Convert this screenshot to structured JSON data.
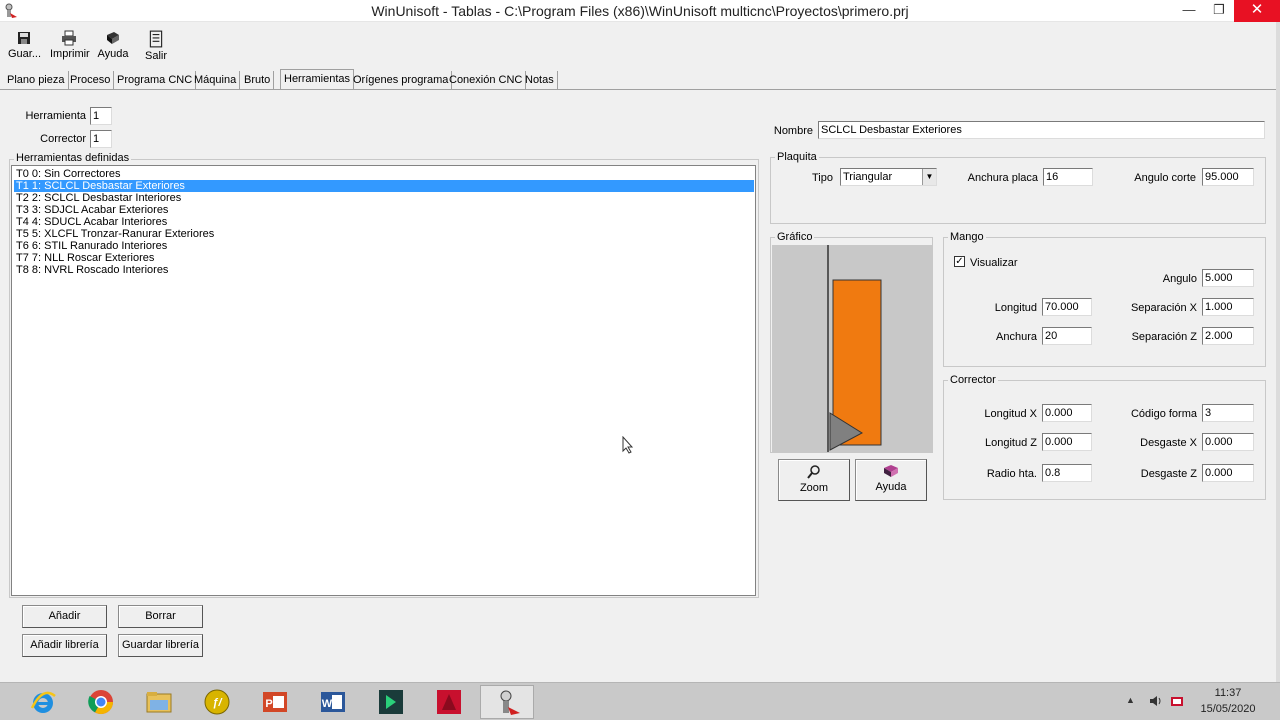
{
  "window": {
    "title": "WinUnisoft - Tablas - C:\\Program Files (x86)\\WinUnisoft multicnc\\Proyectos\\primero.prj",
    "minimize": "—",
    "maximize": "❐",
    "close": "✕"
  },
  "toolbar": {
    "save": "Guar...",
    "print": "Imprimir",
    "help": "Ayuda",
    "exit": "Salir"
  },
  "tabs": [
    "Plano pieza",
    "Proceso",
    "Programa CNC",
    "Máquina",
    "Bruto",
    "Herramientas",
    "Orígenes programa",
    "Conexión CNC",
    "Notas"
  ],
  "active_tab": "Herramientas",
  "left": {
    "herramienta_label": "Herramienta",
    "herramienta_value": "1",
    "corrector_label": "Corrector",
    "corrector_value": "1",
    "list_title": "Herramientas definidas",
    "tools": [
      "T0 0: Sin Correctores",
      "T1 1: SCLCL Desbastar Exteriores",
      "T2 2: SCLCL Desbastar Interiores",
      "T3 3: SDJCL Acabar Exteriores",
      "T4 4: SDUCL Acabar Interiores",
      "T5 5: XLCFL Tronzar-Ranurar Exteriores",
      "T6 6: STIL Ranurado Interiores",
      "T7 7: NLL Roscar Exteriores",
      "T8 8: NVRL Roscado Interiores"
    ],
    "selected_index": 1,
    "btn_add": "Añadir",
    "btn_delete": "Borrar",
    "btn_add_lib": "Añadir librería",
    "btn_save_lib": "Guardar librería"
  },
  "right": {
    "nombre_label": "Nombre",
    "nombre_value": "SCLCL Desbastar Exteriores",
    "plaquita": {
      "title": "Plaquita",
      "tipo_label": "Tipo",
      "tipo_value": "Triangular",
      "anchura_label": "Anchura placa",
      "anchura_value": "16",
      "angulo_label": "Angulo corte",
      "angulo_value": "95.000"
    },
    "grafico": {
      "title": "Gráfico",
      "zoom_label": "Zoom",
      "help_label": "Ayuda",
      "tool_color": "#f07a10",
      "insert_color": "#808080"
    },
    "mango": {
      "title": "Mango",
      "visualizar_label": "Visualizar",
      "visualizar_checked": true,
      "angulo_label": "Angulo",
      "angulo_value": "5.000",
      "longitud_label": "Longitud",
      "longitud_value": "70.000",
      "sepx_label": "Separación X",
      "sepx_value": "1.000",
      "anchura_label": "Anchura",
      "anchura_value": "20",
      "sepz_label": "Separación Z",
      "sepz_value": "2.000"
    },
    "corrector": {
      "title": "Corrector",
      "longx_label": "Longitud X",
      "longx_value": "0.000",
      "codigo_label": "Código forma",
      "codigo_value": "3",
      "longz_label": "Longitud Z",
      "longz_value": "0.000",
      "desgx_label": "Desgaste X",
      "desgx_value": "0.000",
      "radio_label": "Radio hta.",
      "radio_value": "0.8",
      "desgz_label": "Desgaste Z",
      "desgz_value": "0.000"
    }
  },
  "taskbar": {
    "apps": [
      "internet-explorer-icon",
      "chrome-icon",
      "file-explorer-icon",
      "app-circle-icon",
      "powerpoint-icon",
      "word-icon",
      "app-arrow-icon",
      "autocad-icon",
      "winunisoft-icon"
    ],
    "time": "11:37",
    "date": "15/05/2020"
  }
}
